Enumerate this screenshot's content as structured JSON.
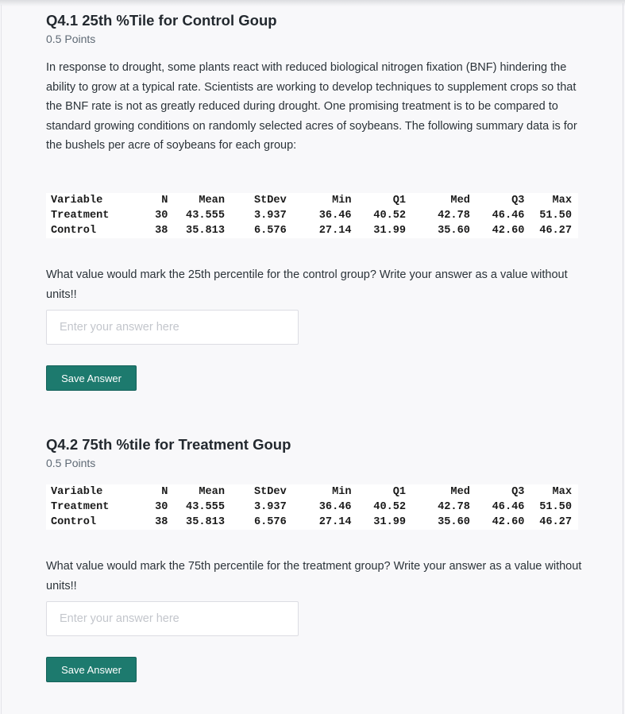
{
  "questions": [
    {
      "number": "Q4.1",
      "title": "25th %Tile for Control Goup",
      "points": "0.5 Points",
      "intro": "In response to drought, some plants react with reduced biological nitrogen fixation (BNF) hindering the ability to grow at a typical rate.  Scientists are working to develop techniques to supplement crops so that the BNF rate is not as greatly reduced during drought.  One promising treatment is to be compared to standard growing conditions on randomly selected acres of soybeans.  The following summary data is for the bushels per acre of soybeans for each group:",
      "table": {
        "headers": [
          "Variable",
          "N",
          "Mean",
          "StDev",
          "Min",
          "Q1",
          "Med",
          "Q3",
          "Max"
        ],
        "rows": [
          [
            "Treatment",
            "30",
            "43.555",
            "3.937",
            "36.46",
            "40.52",
            "42.78",
            "46.46",
            "51.50"
          ],
          [
            "Control",
            "38",
            "35.813",
            "6.576",
            "27.14",
            "31.99",
            "35.60",
            "42.60",
            "46.27"
          ]
        ]
      },
      "prompt": "What value would mark the 25th percentile for the control group?  Write your answer as a value without units!!",
      "input_value": "",
      "input_placeholder": "Enter your answer here",
      "save_label": "Save Answer"
    },
    {
      "number": "Q4.2",
      "title": "75th %tile for Treatment Goup",
      "points": "0.5 Points",
      "table": {
        "headers": [
          "Variable",
          "N",
          "Mean",
          "StDev",
          "Min",
          "Q1",
          "Med",
          "Q3",
          "Max"
        ],
        "rows": [
          [
            "Treatment",
            "30",
            "43.555",
            "3.937",
            "36.46",
            "40.52",
            "42.78",
            "46.46",
            "51.50"
          ],
          [
            "Control",
            "38",
            "35.813",
            "6.576",
            "27.14",
            "31.99",
            "35.60",
            "42.60",
            "46.27"
          ]
        ]
      },
      "prompt": "What value would mark the 75th percentile for the treatment group?  Write your answer as a value without units!!",
      "input_value": "",
      "input_placeholder": "Enter your answer here",
      "save_label": "Save Answer"
    }
  ],
  "colors": {
    "accent": "#1d7a6e",
    "background": "#f8f8fa",
    "text": "#2d3b45"
  }
}
